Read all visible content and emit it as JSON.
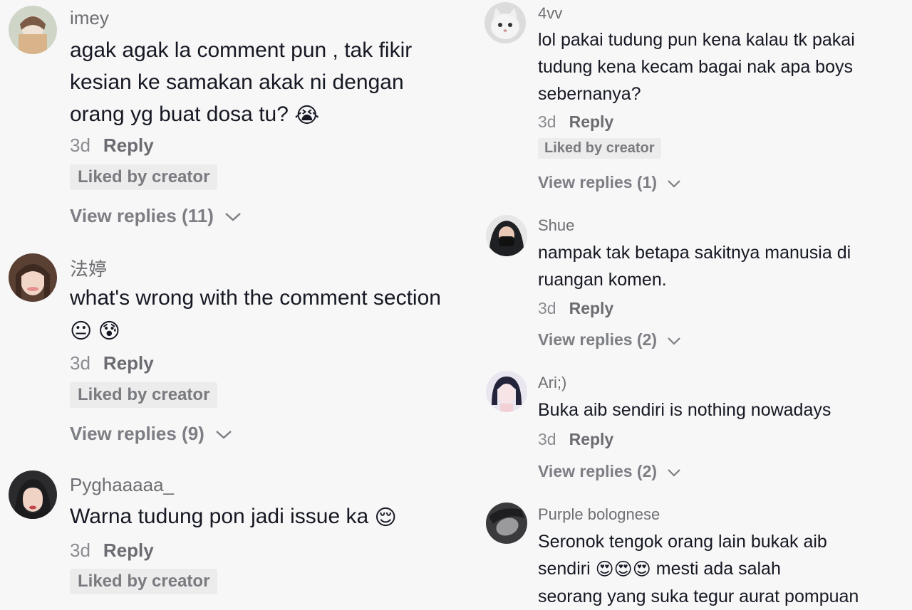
{
  "left_comments": [
    {
      "username": "imey",
      "text": "agak agak la comment pun , tak fikir kesian ke samakan akak ni dengan orang yg buat dosa tu?",
      "emojis": [
        "😭"
      ],
      "time": "3d",
      "reply_label": "Reply",
      "badge": "Liked by creator",
      "view_replies": "View replies (11)"
    },
    {
      "username": "法婷",
      "text": "what's wrong with the comment section",
      "emojis": [
        "😐",
        "😰"
      ],
      "time": "3d",
      "reply_label": "Reply",
      "badge": "Liked by creator",
      "view_replies": "View replies (9)"
    },
    {
      "username": "Pyghaaaaa_",
      "text": "Warna tudung pon jadi issue ka",
      "emojis": [
        "😌"
      ],
      "time": "3d",
      "reply_label": "Reply",
      "badge": "Liked by creator",
      "view_replies": ""
    }
  ],
  "right_comments": [
    {
      "username": "4vv",
      "text": "lol pakai tudung pun kena kalau tk pakai tudung kena kecam bagai nak apa boys sebernanya?",
      "time": "3d",
      "reply_label": "Reply",
      "badge": "Liked by creator",
      "view_replies": "View replies (1)"
    },
    {
      "username": "Shue",
      "text": "nampak tak betapa sakitnya manusia di ruangan komen.",
      "time": "3d",
      "reply_label": "Reply",
      "badge": "",
      "view_replies": "View replies (2)"
    },
    {
      "username": "Ari;)",
      "text": "Buka aib sendiri is nothing nowadays",
      "time": "3d",
      "reply_label": "Reply",
      "badge": "",
      "view_replies": "View replies (2)"
    },
    {
      "username": "Purple bolognese",
      "text_line1": "Seronok tengok orang lain bukak aib",
      "text_line2_a": "sendiri",
      "emojis": [
        "😍",
        "😍",
        "😍"
      ],
      "text_line2_b": "mesti ada salah",
      "text_line3": "seorang yang suka tegur aurat pompuan"
    }
  ],
  "icons": {
    "chevron": "chevron-down-icon"
  },
  "colors": {
    "background": "#f7f7f7",
    "username": "#6e6e73",
    "text": "#161823",
    "meta": "#8a8b91",
    "badge_bg": "#ececec"
  }
}
